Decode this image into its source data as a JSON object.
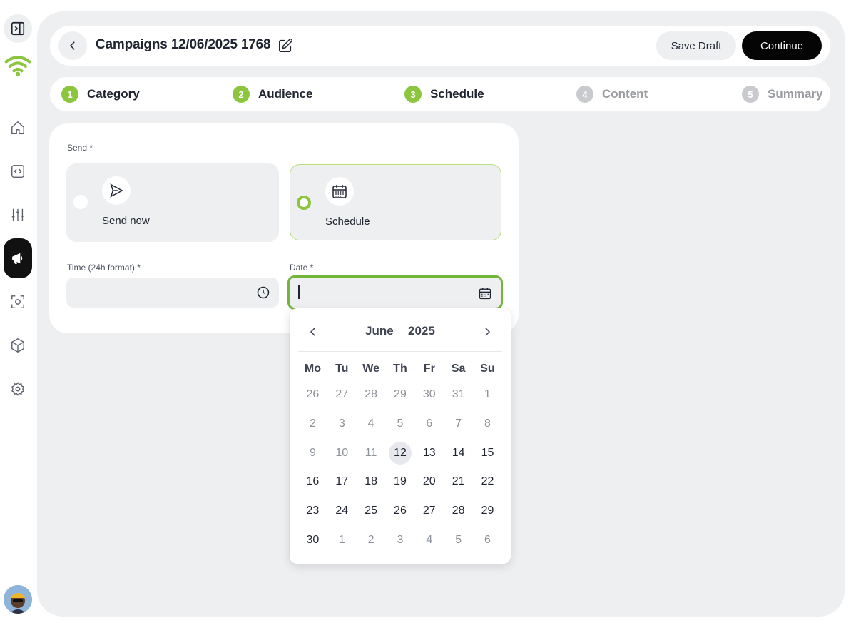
{
  "sidebar": {
    "items": [
      {
        "name": "sidebar-toggle",
        "icon": "sidebar-toggle-icon"
      },
      {
        "name": "logo",
        "icon": "wifi-logo-icon"
      },
      {
        "name": "home",
        "icon": "home-icon"
      },
      {
        "name": "code",
        "icon": "code-icon"
      },
      {
        "name": "sliders",
        "icon": "sliders-icon"
      },
      {
        "name": "campaigns",
        "icon": "megaphone-icon",
        "active": true
      },
      {
        "name": "scan",
        "icon": "scan-icon"
      },
      {
        "name": "cube",
        "icon": "cube-icon"
      },
      {
        "name": "settings",
        "icon": "gear-icon"
      },
      {
        "name": "avatar",
        "icon": "avatar"
      }
    ]
  },
  "header": {
    "title": "Campaigns 12/06/2025 1768",
    "save_draft_label": "Save Draft",
    "continue_label": "Continue"
  },
  "stepper": {
    "steps": [
      {
        "num": "1",
        "label": "Category",
        "state": "done"
      },
      {
        "num": "2",
        "label": "Audience",
        "state": "done"
      },
      {
        "num": "3",
        "label": "Schedule",
        "state": "done"
      },
      {
        "num": "4",
        "label": "Content",
        "state": "todo"
      },
      {
        "num": "5",
        "label": "Summary",
        "state": "todo"
      }
    ]
  },
  "form": {
    "send_label": "Send *",
    "options": [
      {
        "label": "Send now",
        "icon": "send-icon",
        "selected": false
      },
      {
        "label": "Schedule",
        "icon": "calendar-icon",
        "selected": true
      }
    ],
    "time_label": "Time (24h format) *",
    "time_value": "",
    "date_label": "Date *",
    "date_value": ""
  },
  "calendar": {
    "month": "June",
    "year": "2025",
    "weekdays": [
      "Mo",
      "Tu",
      "We",
      "Th",
      "Fr",
      "Sa",
      "Su"
    ],
    "days": [
      {
        "d": "26",
        "s": "muted"
      },
      {
        "d": "27",
        "s": "muted"
      },
      {
        "d": "28",
        "s": "muted"
      },
      {
        "d": "29",
        "s": "muted"
      },
      {
        "d": "30",
        "s": "muted"
      },
      {
        "d": "31",
        "s": "muted"
      },
      {
        "d": "1",
        "s": "muted"
      },
      {
        "d": "2",
        "s": "muted"
      },
      {
        "d": "3",
        "s": "muted"
      },
      {
        "d": "4",
        "s": "muted"
      },
      {
        "d": "5",
        "s": "muted"
      },
      {
        "d": "6",
        "s": "muted"
      },
      {
        "d": "7",
        "s": "muted"
      },
      {
        "d": "8",
        "s": "muted"
      },
      {
        "d": "9",
        "s": "muted"
      },
      {
        "d": "10",
        "s": "muted"
      },
      {
        "d": "11",
        "s": "muted"
      },
      {
        "d": "12",
        "s": "today"
      },
      {
        "d": "13",
        "s": "active"
      },
      {
        "d": "14",
        "s": "active"
      },
      {
        "d": "15",
        "s": "active"
      },
      {
        "d": "16",
        "s": "active"
      },
      {
        "d": "17",
        "s": "active"
      },
      {
        "d": "18",
        "s": "active"
      },
      {
        "d": "19",
        "s": "active"
      },
      {
        "d": "20",
        "s": "active"
      },
      {
        "d": "21",
        "s": "active"
      },
      {
        "d": "22",
        "s": "active"
      },
      {
        "d": "23",
        "s": "active"
      },
      {
        "d": "24",
        "s": "active"
      },
      {
        "d": "25",
        "s": "active"
      },
      {
        "d": "26",
        "s": "active"
      },
      {
        "d": "27",
        "s": "active"
      },
      {
        "d": "28",
        "s": "active"
      },
      {
        "d": "29",
        "s": "active"
      },
      {
        "d": "30",
        "s": "active"
      },
      {
        "d": "1",
        "s": "muted"
      },
      {
        "d": "2",
        "s": "muted"
      },
      {
        "d": "3",
        "s": "muted"
      },
      {
        "d": "4",
        "s": "muted"
      },
      {
        "d": "5",
        "s": "muted"
      },
      {
        "d": "6",
        "s": "muted"
      }
    ]
  },
  "colors": {
    "accent_green": "#8cc63f",
    "focus_green": "#73b43a",
    "primary_button": "#050505",
    "surface": "#eeeff1"
  }
}
